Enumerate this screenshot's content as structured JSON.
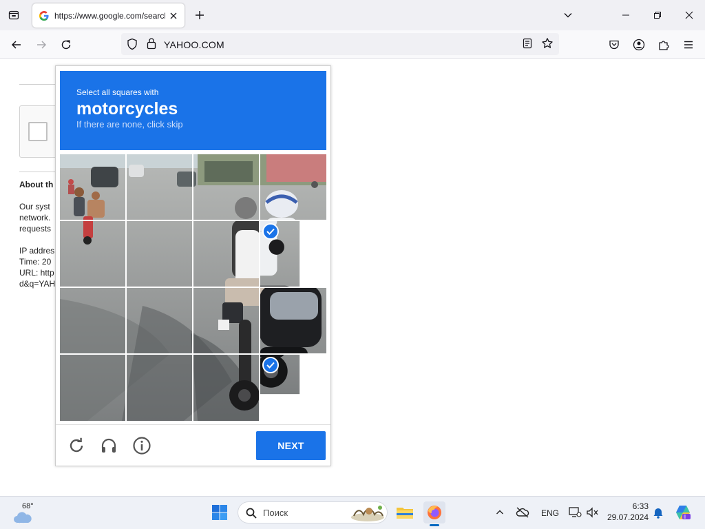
{
  "browser": {
    "tab": {
      "title": "https://www.google.com/search",
      "close_label": "×"
    },
    "url": "YAHOO.COM"
  },
  "page": {
    "about_title": "About th",
    "lines": [
      "Our syst",
      "network.",
      "requests",
      "",
      "IP addres",
      "Time: 20",
      "URL: http",
      "d&q=YAH"
    ]
  },
  "captcha": {
    "instruction": "Select all squares with",
    "target": "motorcycles",
    "subtext": "If there are none, click skip",
    "selected_tiles": [
      7,
      15
    ],
    "next_label": "NEXT",
    "footer_icons": [
      "reload-icon",
      "audio-headphones-icon",
      "info-icon"
    ],
    "accent": "#1a73e8"
  },
  "taskbar": {
    "weather_temp": "68°",
    "search_placeholder": "Поиск",
    "lang": "ENG",
    "time": "6:33",
    "date": "29.07.2024"
  }
}
